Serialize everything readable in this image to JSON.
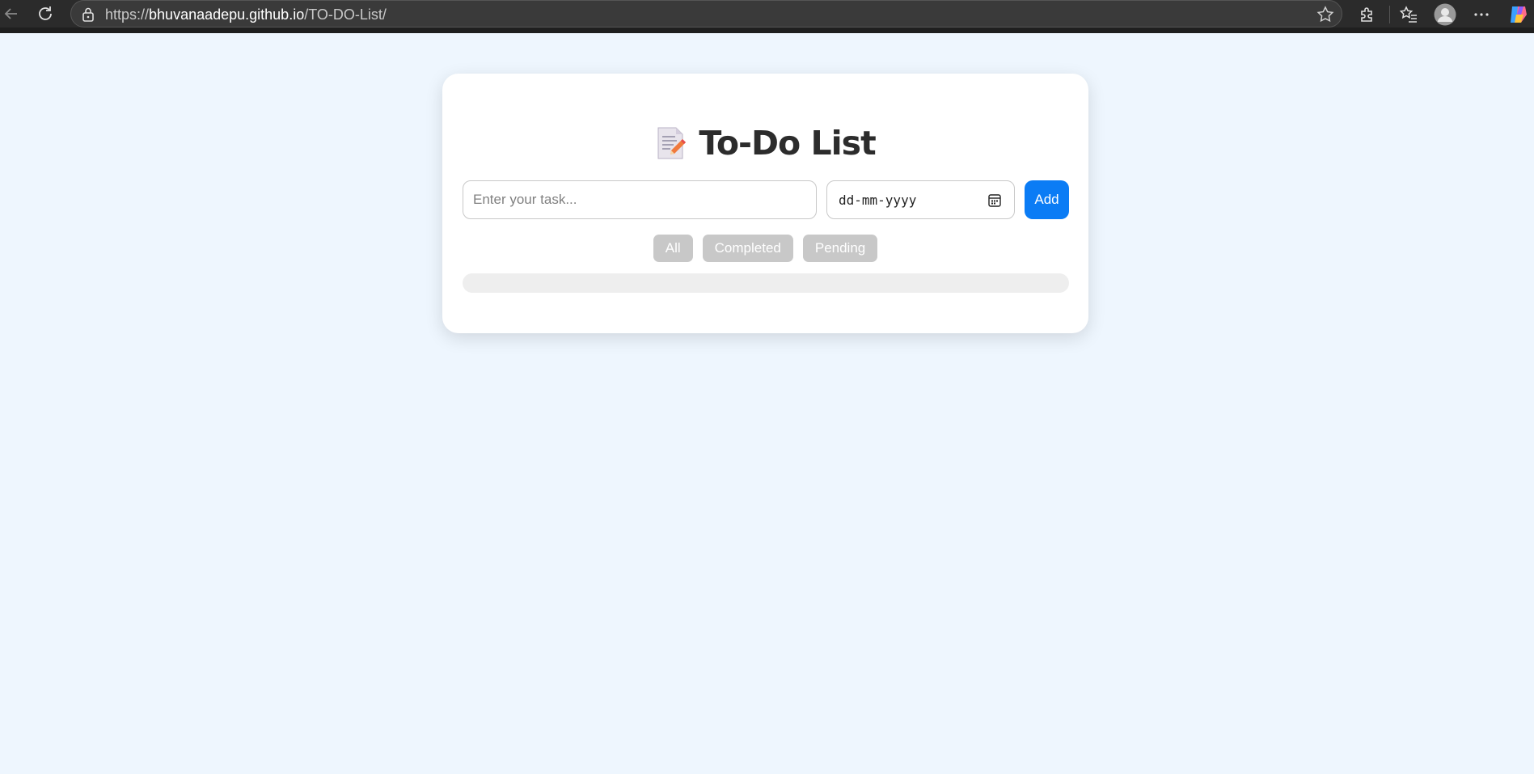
{
  "browser": {
    "url_prefix": "https://",
    "url_host": "bhuvanaadepu.github.io",
    "url_path": "/TO-DO-List/"
  },
  "app": {
    "title": "To-Do List",
    "title_icon": "memo-icon",
    "task_placeholder": "Enter your task...",
    "task_value": "",
    "date_placeholder": "dd-mm-yyyy",
    "add_label": "Add",
    "filters": [
      {
        "label": "All"
      },
      {
        "label": "Completed"
      },
      {
        "label": "Pending"
      }
    ],
    "tasks": []
  },
  "colors": {
    "page_bg": "#eef6fe",
    "accent": "#0b7cf5",
    "filter_bg": "#c8c8c8",
    "list_bg": "#eeeeee"
  }
}
